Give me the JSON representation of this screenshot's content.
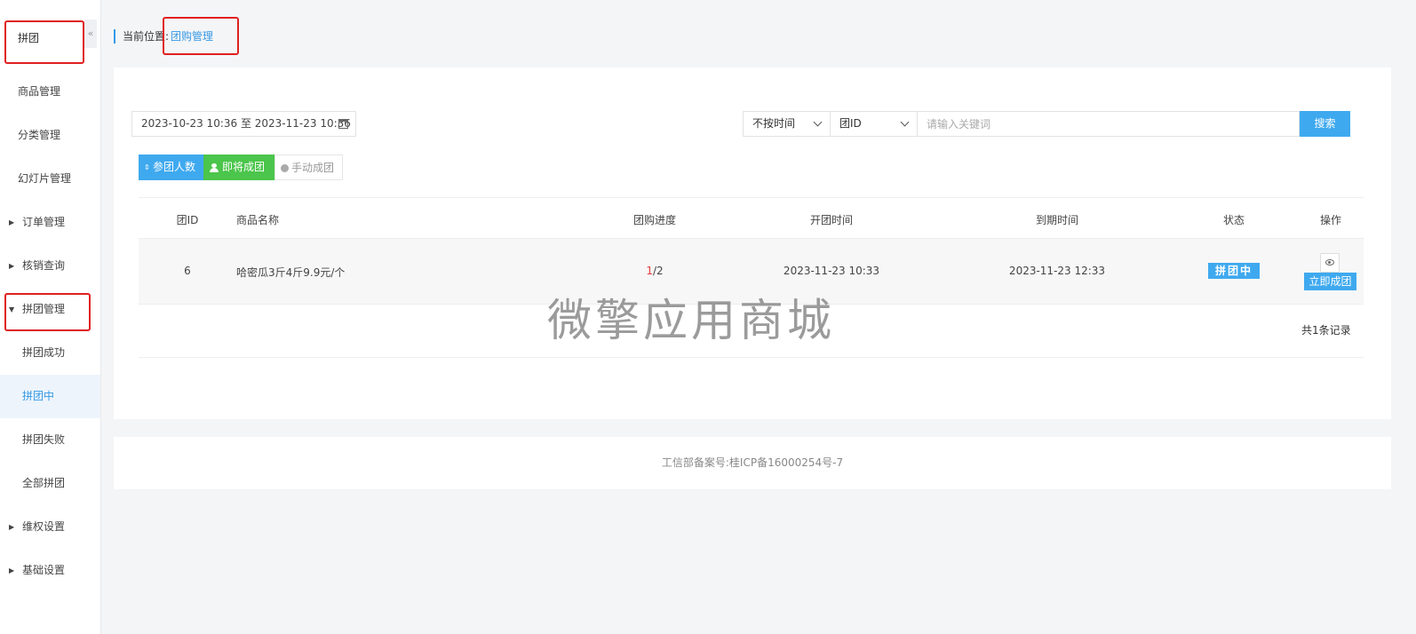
{
  "sidebar": {
    "title": "拼团",
    "collapse_glyph": "«",
    "items": [
      {
        "label": "商品管理"
      },
      {
        "label": "分类管理"
      },
      {
        "label": "幻灯片管理"
      },
      {
        "label": "订单管理"
      },
      {
        "label": "核销查询"
      },
      {
        "label": "拼团管理"
      },
      {
        "label": "拼团成功"
      },
      {
        "label": "拼团中"
      },
      {
        "label": "拼团失败"
      },
      {
        "label": "全部拼团"
      },
      {
        "label": "维权设置"
      },
      {
        "label": "基础设置"
      }
    ]
  },
  "breadcrumb": {
    "label": "当前位置:",
    "current": "团购管理"
  },
  "filters": {
    "date_range": "2023-10-23 10:36 至 2023-11-23 10:36",
    "time_select": "不按时间",
    "field_select": "团ID",
    "keyword_placeholder": "请输入关键词",
    "search_label": "搜索"
  },
  "sort_buttons": {
    "participants": "参团人数",
    "about_to_complete": "即将成团",
    "manual_complete": "手动成团"
  },
  "table": {
    "headers": [
      "团ID",
      "商品名称",
      "团购进度",
      "开团时间",
      "到期时间",
      "状态",
      "操作"
    ],
    "rows": [
      {
        "id": "6",
        "product": "哈密瓜3斤4斤9.9元/个",
        "progress_done": "1",
        "progress_total": "/2",
        "start_time": "2023-11-23 10:33",
        "end_time": "2023-11-23 12:33",
        "status": "拼团中",
        "action_label": "立即成团"
      }
    ],
    "record_count": "共1条记录"
  },
  "watermark": "微擎应用商城",
  "footer": {
    "icp": "工信部备案号:桂ICP备16000254号-7"
  },
  "colors": {
    "accent": "#3fa9ef",
    "green": "#4bc54b",
    "highlight": "#e02020",
    "progress_done": "#e53c3c"
  }
}
